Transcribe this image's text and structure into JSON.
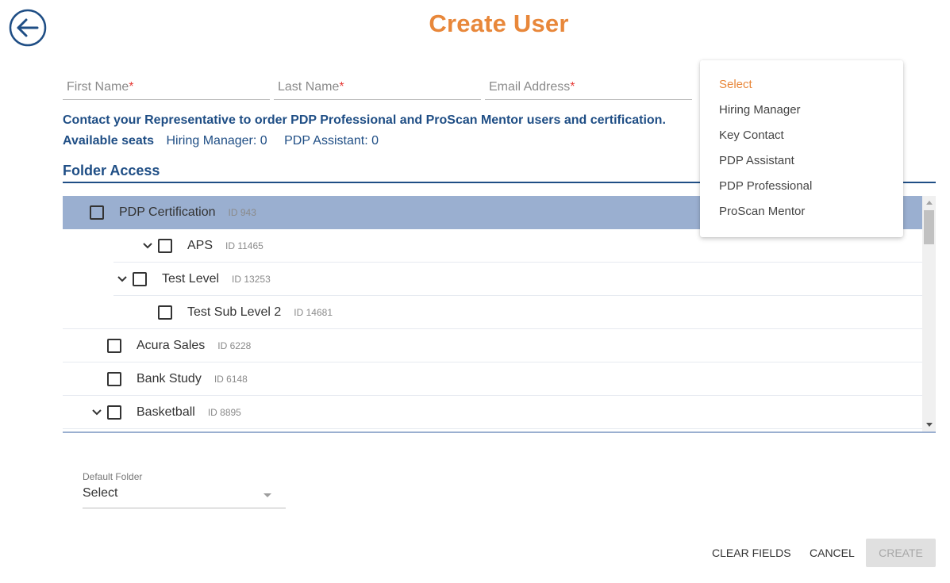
{
  "header": {
    "title": "Create User",
    "back_icon": "arrow-circle-left-icon"
  },
  "colors": {
    "title_accent": "#e8873a",
    "brand_blue": "#1f4e85",
    "selected_row": "#9aafd0",
    "required_star": "#e53935"
  },
  "form": {
    "first_name": {
      "placeholder": "First Name",
      "required_mark": "*",
      "value": ""
    },
    "last_name": {
      "placeholder": "Last Name",
      "required_mark": "*",
      "value": ""
    },
    "email": {
      "placeholder": "Email Address",
      "required_mark": "*",
      "value": ""
    }
  },
  "notice": "Contact your Representative to order PDP Professional and ProScan Mentor users and certification.",
  "seats": {
    "label": "Available seats",
    "items": [
      "Hiring Manager: 0",
      "PDP Assistant: 0"
    ]
  },
  "folder_access": {
    "title": "Folder Access",
    "folders": [
      {
        "name": "PDP Certification",
        "id": "ID 943",
        "selected": true,
        "expandable": false
      },
      {
        "name": "APS",
        "id": "ID 11465",
        "selected": false,
        "expandable": true
      },
      {
        "name": "Test Level",
        "id": "ID 13253",
        "selected": false,
        "expandable": true
      },
      {
        "name": "Test Sub Level 2",
        "id": "ID 14681",
        "selected": false,
        "expandable": false
      },
      {
        "name": "Acura Sales",
        "id": "ID 6228",
        "selected": false,
        "expandable": false
      },
      {
        "name": "Bank Study",
        "id": "ID 6148",
        "selected": false,
        "expandable": false
      },
      {
        "name": "Basketball",
        "id": "ID 8895",
        "selected": false,
        "expandable": true
      }
    ]
  },
  "role_dropdown": {
    "options": [
      "Select",
      "Hiring Manager",
      "Key Contact",
      "PDP Assistant",
      "PDP Professional",
      "ProScan Mentor"
    ],
    "highlighted": "Select"
  },
  "default_folder": {
    "label": "Default Folder",
    "value": "Select"
  },
  "actions": {
    "clear": "CLEAR FIELDS",
    "cancel": "CANCEL",
    "create": "CREATE"
  }
}
